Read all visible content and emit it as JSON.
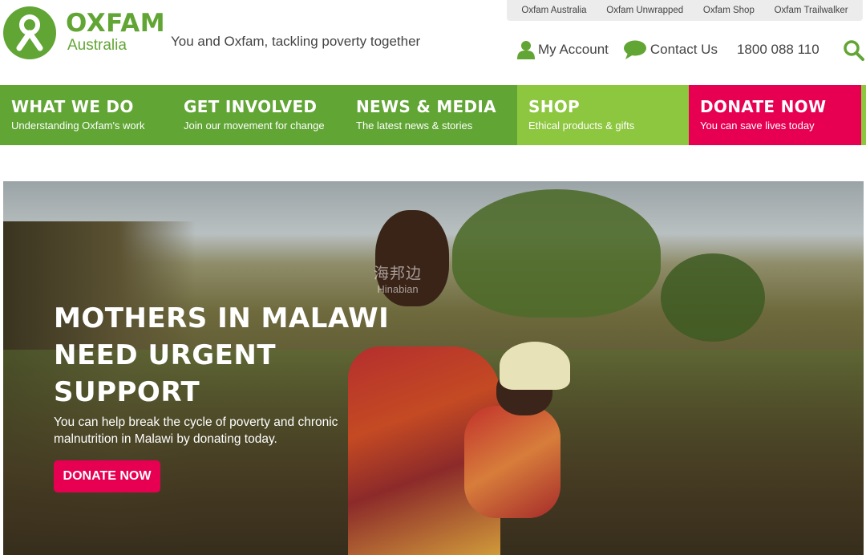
{
  "brand": {
    "name": "OXFAM",
    "region": "Australia",
    "tagline": "You and Oxfam, tackling poverty together",
    "color_primary": "#61a534",
    "color_secondary": "#8dc63f",
    "color_accent": "#e70052"
  },
  "top_links": [
    {
      "label": "Oxfam Australia"
    },
    {
      "label": "Oxfam Unwrapped"
    },
    {
      "label": "Oxfam Shop"
    },
    {
      "label": "Oxfam Trailwalker"
    }
  ],
  "utilities": {
    "account_label": "My Account",
    "account_icon": "user-icon",
    "contact_label": "Contact Us",
    "contact_icon": "speech-bubble-icon",
    "phone": "1800 088 110",
    "search_icon": "search-icon"
  },
  "nav": [
    {
      "title": "What we do",
      "subtitle": "Understanding Oxfam's work",
      "color": "#61a534"
    },
    {
      "title": "Get involved",
      "subtitle": "Join our movement for change",
      "color": "#61a534"
    },
    {
      "title": "News & media",
      "subtitle": "The latest news & stories",
      "color": "#61a534"
    },
    {
      "title": "Shop",
      "subtitle": "Ethical products & gifts",
      "color": "#8dc63f"
    },
    {
      "title": "Donate now",
      "subtitle": "You can save lives today",
      "color": "#e70052"
    }
  ],
  "hero": {
    "title": "Mothers in Malawi need urgent support",
    "text": "You can help break the cycle of poverty and chronic malnutrition in Malawi by donating today.",
    "button_label": "Donate now"
  },
  "watermark": {
    "line1": "海邦边",
    "line2": "Hinabian"
  }
}
